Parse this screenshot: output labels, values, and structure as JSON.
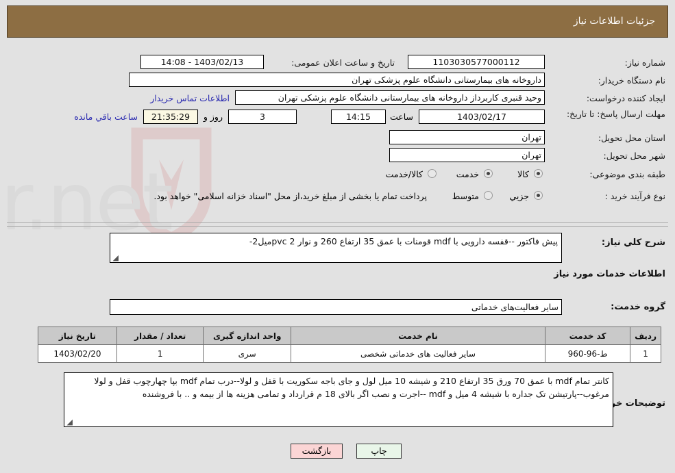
{
  "header": {
    "title": "جزئیات اطلاعات نیاز"
  },
  "form": {
    "need_number_label": "شماره نیاز:",
    "need_number_value": "1103030577000112",
    "public_announce_label": "تاریخ و ساعت اعلان عمومی:",
    "public_announce_value": "1403/02/13 - 14:08",
    "buyer_org_label": "نام دستگاه خریدار:",
    "buyer_org_value": "داروخانه های بیمارستانی دانشگاه علوم پزشکی تهران",
    "creator_label": "ایجاد کننده درخواست:",
    "creator_value": "وحید قنبری کاربرداز داروخانه های بیمارستانی دانشگاه علوم پزشکی تهران",
    "contact_link": "اطلاعات تماس خریدار",
    "deadline_label": "مهلت ارسال پاسخ: تا تاریخ:",
    "deadline_date": "1403/02/17",
    "deadline_hour_label": "ساعت",
    "deadline_hour": "14:15",
    "days_value": "3",
    "days_unit_label": "روز و",
    "countdown_value": "21:35:29",
    "countdown_note": "ساعت باقي مانده",
    "province_label": "استان محل تحویل:",
    "province_value": "تهران",
    "city_label": "شهر محل تحویل:",
    "city_value": "تهران",
    "category_label": "طبقه بندی موضوعی:",
    "category_options": [
      "کالا",
      "خدمت",
      "کالا/خدمت"
    ],
    "category_selected": 1,
    "process_label": "نوع فرآیند خرید :",
    "process_options": [
      "جزیي",
      "متوسط"
    ],
    "process_selected": 0,
    "payment_note": "پرداخت تمام یا بخشی از مبلغ خرید،از محل \"اسناد خزانه اسلامی\" خواهد بود."
  },
  "summary": {
    "label": "شرح کلي نیاز:",
    "value": "پیش فاکتور --قفسه دارویی با mdf  قومنات با عمق 35 ارتفاع 260 و نوار 2 pvcمیل2-"
  },
  "services_section": {
    "heading": "اطلاعات خدمات مورد نیاز",
    "group_label": "گروه خدمت:",
    "group_value": "سایر فعالیت‌های خدماتی"
  },
  "table": {
    "headers": [
      "ردیف",
      "کد خدمت",
      "نام خدمت",
      "واحد اندازه گیری",
      "تعداد / مقدار",
      "تاریخ نیاز"
    ],
    "rows": [
      [
        "1",
        "ط-96-960",
        "سایر فعالیت های خدماتی شخصی",
        "سری",
        "1",
        "1403/02/20"
      ]
    ]
  },
  "notes": {
    "label": "توضیحات خریدار:",
    "value": "کانتر تمام mdf با عمق 70 ورق 35 ارتفاع 210 و شیشه 10 میل لول و جای باجه سکوریت با قفل و لولا--درب تمام mdf بپا چهارچوب قفل و لولا مرغوب--پارتیشن تک جداره با شیشه 4 میل و mdf --اجرت و نصب اگر بالای 18 م قرارداد و تمامی هزینه ها از بیمه و .. با فروشنده"
  },
  "buttons": {
    "print": "چاپ",
    "back": "بازگشت"
  },
  "watermark": {
    "text": "AriaTender.net"
  },
  "colors": {
    "header_bar": "#8d6e43",
    "page_bg": "#e2e2e2",
    "link": "#2a2ab0",
    "print_btn": "#e9f6e9",
    "back_btn": "#fbd5d5",
    "table_header": "#c9c9c9",
    "countdown_bg": "#fbf8e3"
  }
}
